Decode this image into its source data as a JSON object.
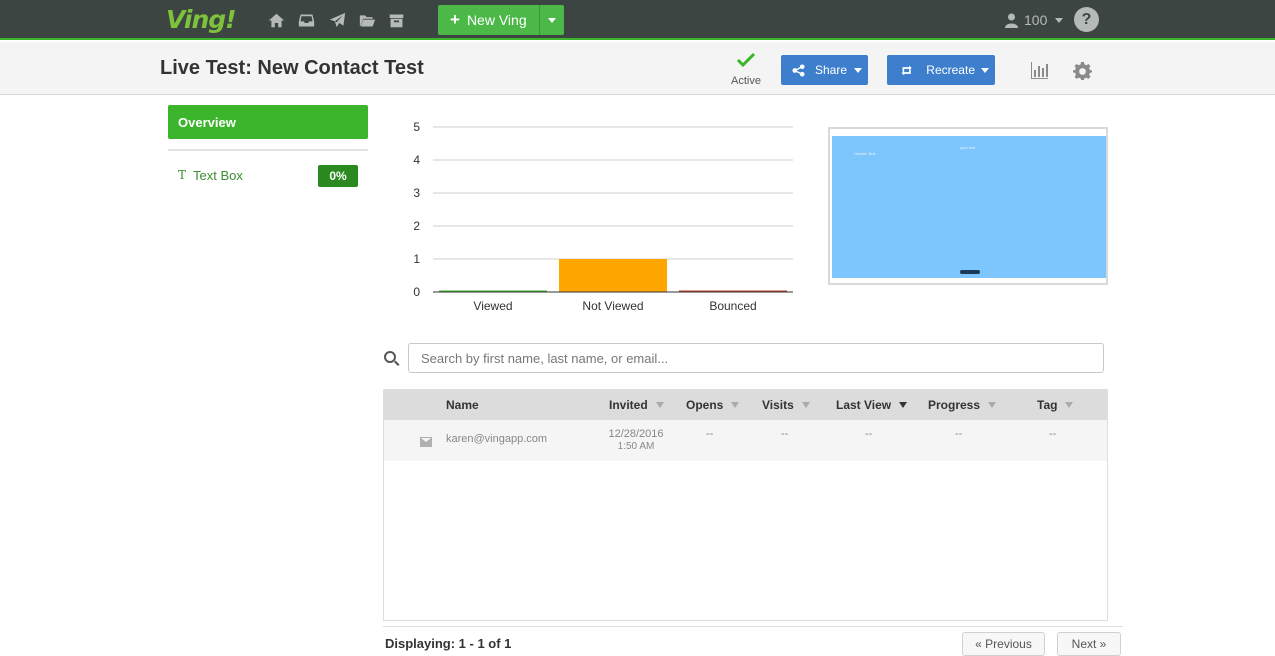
{
  "topbar": {
    "logo": "Ving!",
    "nav_icons": [
      "home-icon",
      "inbox-icon",
      "send-icon",
      "folder-open-icon",
      "archive-icon"
    ],
    "new_ving_label": "New Ving",
    "credits": "100",
    "help": "?"
  },
  "header": {
    "title": "Live Test: New Contact Test",
    "status_label": "Active",
    "share_label": "Share",
    "recreate_label": "Recreate"
  },
  "sidebar": {
    "overview_label": "Overview",
    "items": [
      {
        "icon": "T",
        "label": "Text Box",
        "badge": "0%"
      }
    ]
  },
  "chart_data": {
    "type": "bar",
    "categories": [
      "Viewed",
      "Not Viewed",
      "Bounced"
    ],
    "values": [
      0,
      1,
      0
    ],
    "colors": [
      "#3cb52c",
      "#ffa500",
      "#c0392b"
    ],
    "ylim": [
      0,
      5
    ],
    "yticks": [
      0,
      1,
      2,
      3,
      4,
      5
    ],
    "grid": true
  },
  "preview": {
    "left_text": "Header Text",
    "center_text": "your text",
    "button_text": "Button"
  },
  "search": {
    "placeholder": "Search by first name, last name, or email..."
  },
  "table": {
    "columns": [
      "Name",
      "Invited",
      "Opens",
      "Visits",
      "Last View",
      "Progress",
      "Tag"
    ],
    "rows": [
      {
        "name": "karen@vingapp.com",
        "invited_date": "12/28/2016",
        "invited_time": "1:50 AM",
        "opens": "--",
        "visits": "--",
        "last_view": "--",
        "progress": "--",
        "tag": "--"
      }
    ]
  },
  "footer": {
    "displaying": "Displaying: 1 - 1 of 1",
    "prev_label": "« Previous",
    "next_label": "Next »"
  },
  "colors": {
    "brand_green": "#3cb52c",
    "topbar": "#3d4543",
    "button_blue": "#3d7fcc",
    "bar_not_viewed": "#ffa500"
  }
}
